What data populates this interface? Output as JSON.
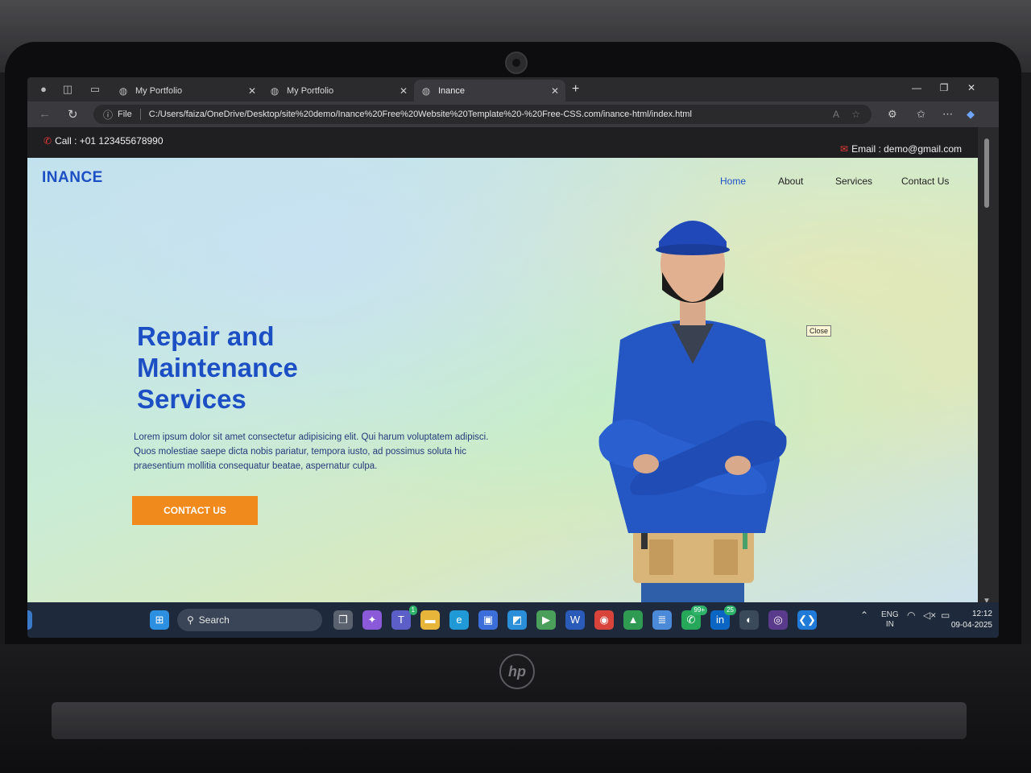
{
  "browser": {
    "tabs": [
      {
        "title": "My Portfolio",
        "active": false
      },
      {
        "title": "My Portfolio",
        "active": false
      },
      {
        "title": "Inance",
        "active": true
      }
    ],
    "address": {
      "scheme_label": "File",
      "url": "C:/Users/faiza/OneDrive/Desktop/site%20demo/Inance%20Free%20Website%20Template%20-%20Free-CSS.com/inance-html/index.html"
    }
  },
  "page": {
    "topbar": {
      "call": "Call : +01 123455678990",
      "email": "Email : demo@gmail.com"
    },
    "brand": "INANCE",
    "nav": [
      {
        "label": "Home",
        "active": true
      },
      {
        "label": "About",
        "active": false
      },
      {
        "label": "Services",
        "active": false
      },
      {
        "label": "Contact Us",
        "active": false
      }
    ],
    "hero": {
      "title_line1": "Repair and",
      "title_line2": "Maintenance",
      "title_line3": "Services",
      "text": "Lorem ipsum dolor sit amet consectetur adipisicing elit. Qui harum voluptatem adipisci. Quos molestiae saepe dicta nobis pariatur, tempora iusto, ad possimus soluta hic praesentium mollitia consequatur beatae, aspernatur culpa.",
      "cta": "CONTACT US"
    },
    "tooltip": "Close"
  },
  "taskbar": {
    "search": "Search",
    "badges": {
      "teams": "1",
      "whatsapp": "99+",
      "linkedin": "25"
    },
    "lang_top": "ENG",
    "lang_bottom": "IN",
    "time": "12:12",
    "date": "09-04-2025"
  },
  "colors": {
    "brand_blue": "#1d4fc4",
    "cta_orange": "#f08a1d",
    "accent_red": "#e53935"
  }
}
